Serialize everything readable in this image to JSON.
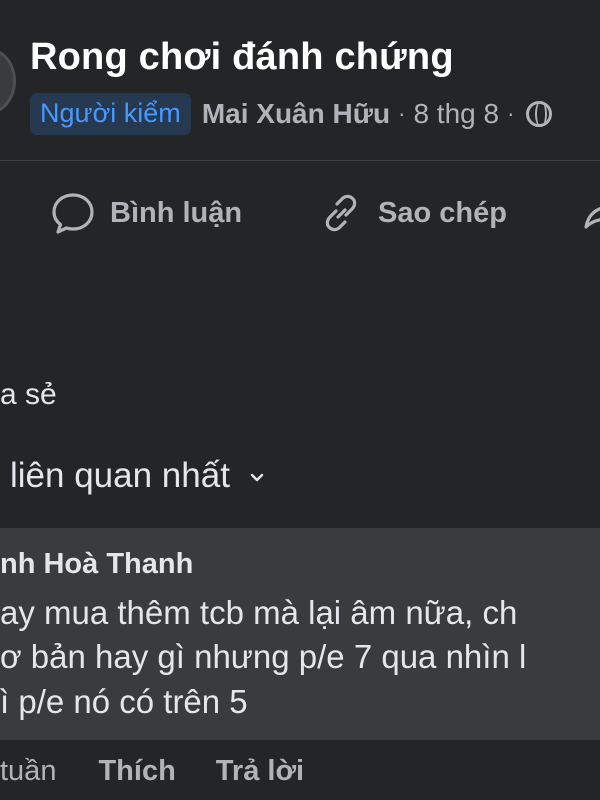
{
  "post": {
    "group_name": "Rong chơi đánh chứng",
    "role_badge": "Người kiểm",
    "author": "Mai Xuân Hữu",
    "separator": "·",
    "date": "8 thg 8",
    "visibility_icon": "globe-icon"
  },
  "actions": {
    "comment_label": "Bình luận",
    "copy_label": "Sao chép",
    "comment_icon": "comment-icon",
    "copy_icon": "link-icon",
    "share_icon": "share-icon"
  },
  "shares_text": "a sẻ",
  "sort": {
    "label": "liên quan nhất",
    "icon": "chevron-down-icon"
  },
  "comment": {
    "author": "nh Hoà Thanh",
    "lines": [
      "ay mua thêm tcb mà lại âm nữa, ch",
      "ơ bản hay gì nhưng p/e 7 qua nhìn l",
      "ì p/e nó có trên 5"
    ],
    "time": "tuần",
    "like_label": "Thích",
    "reply_label": "Trả lời"
  },
  "colors": {
    "background": "#242526",
    "bubble": "#3a3b3c",
    "badge_bg": "#263951",
    "badge_text": "#4599ff",
    "secondary_text": "#b0b3b8",
    "primary_text": "#e4e6eb"
  }
}
